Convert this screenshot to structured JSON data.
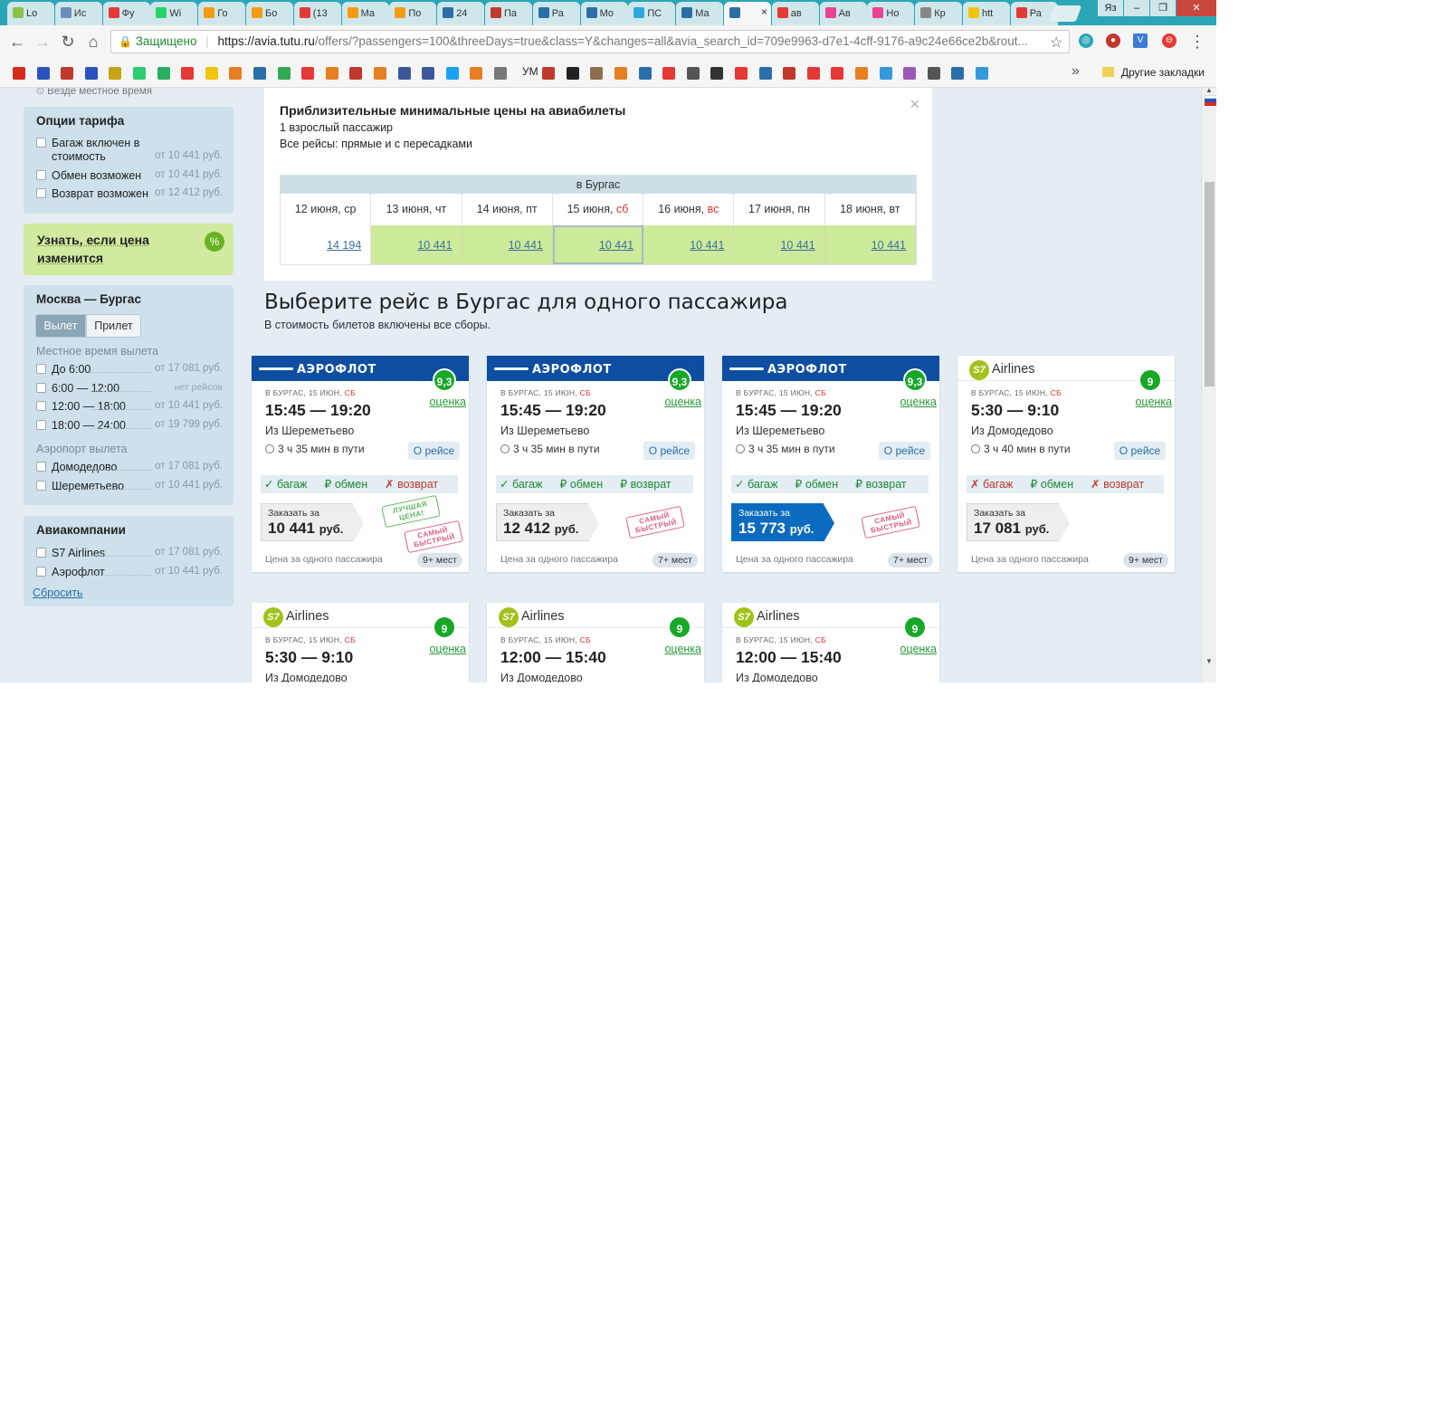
{
  "browser": {
    "tabs": [
      {
        "label": "Lo",
        "color": "#8bc34a"
      },
      {
        "label": "Ис",
        "color": "#6c8ebf"
      },
      {
        "label": "Фу",
        "color": "#e53935"
      },
      {
        "label": "Wi",
        "color": "#25d366"
      },
      {
        "label": "Го",
        "color": "#f39c12"
      },
      {
        "label": "Бо",
        "color": "#f39c12"
      },
      {
        "label": "(13",
        "color": "#e53935"
      },
      {
        "label": "Ма",
        "color": "#f39c12"
      },
      {
        "label": "По",
        "color": "#f39c12"
      },
      {
        "label": "24",
        "color": "#2a6fa8"
      },
      {
        "label": "Па",
        "color": "#c0392b"
      },
      {
        "label": "Ра",
        "color": "#2a6fa8"
      },
      {
        "label": "Мо",
        "color": "#2a6fa8"
      },
      {
        "label": "ПС",
        "color": "#29a8e0"
      },
      {
        "label": "Ма",
        "color": "#2a6fa8"
      },
      {
        "label": "",
        "color": "#2a6fa8"
      },
      {
        "label": "ав",
        "color": "#e53935"
      },
      {
        "label": "Ав",
        "color": "#e84393"
      },
      {
        "label": "Но",
        "color": "#e84393"
      },
      {
        "label": "Кр",
        "color": "#888"
      },
      {
        "label": "htt",
        "color": "#f1c40f"
      },
      {
        "label": "Ра",
        "color": "#e53935"
      }
    ],
    "active_tab_index": 15,
    "tab_close": "×",
    "omnibox": {
      "secure_label": "Защищено",
      "url_host": "https://avia.tutu.ru",
      "url_path": "/offers/?passengers=100&threeDays=true&class=Y&changes=all&avia_search_id=709e9963-d7e1-4cff-9176-a9c24e66ce2b&rout..."
    },
    "bookmarks_other": "Другие закладки",
    "bookmark_more": "»",
    "bookmark_um": "УМ"
  },
  "sidebar": {
    "tz_note": "Везде местное время",
    "tariff": {
      "title": "Опции тарифа",
      "options": [
        {
          "label": "Багаж включен в стоимость",
          "price": "от 10 441 руб."
        },
        {
          "label": "Обмен возможен",
          "price": "от 10 441 руб."
        },
        {
          "label": "Возврат возможен",
          "price": "от 12 412 руб."
        }
      ]
    },
    "notify": {
      "label": "Узнать, если цена изменится",
      "badge": "%"
    },
    "route": {
      "title": "Москва — Бургас",
      "toggle_dep": "Вылет",
      "toggle_arr": "Прилет",
      "time_head": "Местное время вылета",
      "times": [
        {
          "label": "До 6:00",
          "price": "от 17 081 руб."
        },
        {
          "label": "6:00 — 12:00",
          "price": "нет рейсов"
        },
        {
          "label": "12:00 — 18:00",
          "price": "от 10 441 руб."
        },
        {
          "label": "18:00 — 24:00",
          "price": "от 19 799 руб."
        }
      ],
      "airport_head": "Аэропорт вылета",
      "airports": [
        {
          "label": "Домодедово",
          "price": "от 17 081 руб."
        },
        {
          "label": "Шереметьево",
          "price": "от 10 441 руб."
        }
      ]
    },
    "airlines": {
      "title": "Авиакомпании",
      "items": [
        {
          "label": "S7 Airlines",
          "price": "от 17 081 руб."
        },
        {
          "label": "Аэрофлот",
          "price": "от 10 441 руб."
        }
      ],
      "reset": "Сбросить"
    }
  },
  "calendar": {
    "title": "Приблизительные минимальные цены на авиабилеты",
    "sub1": "1 взрослый пассажир",
    "sub2": "Все рейсы: прямые и с пересадками",
    "close": "×",
    "destination": "в Бургас",
    "days": [
      {
        "date": "12 июня,",
        "wd": "ср",
        "weekend": false,
        "price": "14 194",
        "cheap": false
      },
      {
        "date": "13 июня,",
        "wd": "чт",
        "weekend": false,
        "price": "10 441",
        "cheap": true
      },
      {
        "date": "14 июня,",
        "wd": "пт",
        "weekend": false,
        "price": "10 441",
        "cheap": true
      },
      {
        "date": "15 июня,",
        "wd": "сб",
        "weekend": true,
        "price": "10 441",
        "cheap": true,
        "selected": true
      },
      {
        "date": "16 июня,",
        "wd": "вс",
        "weekend": true,
        "price": "10 441",
        "cheap": true
      },
      {
        "date": "17 июня,",
        "wd": "пн",
        "weekend": false,
        "price": "10 441",
        "cheap": true
      },
      {
        "date": "18 июня,",
        "wd": "вт",
        "weekend": false,
        "price": "10 441",
        "cheap": true
      }
    ]
  },
  "results": {
    "title": "Выберите рейс в Бургас для одного пассажира",
    "subtitle": "В стоимость билетов включены все сборы.",
    "rating_label": "оценка",
    "about_label": "О рейсе",
    "book_label": "Заказать за",
    "currency": "руб.",
    "per_pax": "Цена за одного пассажира",
    "opt_baggage": "багаж",
    "opt_exchange": "обмен",
    "opt_refund": "возврат",
    "airline_logo_aero": "АЭРОФЛОТ",
    "airline_logo_s7_badge": "S7",
    "airline_logo_s7_text": "Airlines",
    "dir_prefix": "В БУРГАС, 15 ИЮН,",
    "dir_day": "СБ",
    "stamp_best": "ЛУЧШАЯ ЦЕНА!",
    "stamp_fast": "САМЫЙ БЫСТРЫЙ",
    "cards": [
      {
        "airline": "aero",
        "rating": "9,3",
        "time": "15:45 — 19:20",
        "from": "Из Шереметьево",
        "duration": "3 ч 35 мин в пути",
        "baggage": true,
        "exchange": "rub",
        "refund": false,
        "price": "10 441",
        "seats": "9+ мест",
        "stamps": [
          "best",
          "fast"
        ],
        "highlight": false
      },
      {
        "airline": "aero",
        "rating": "9,3",
        "time": "15:45 — 19:20",
        "from": "Из Шереметьево",
        "duration": "3 ч 35 мин в пути",
        "baggage": true,
        "exchange": "rub",
        "refund": "rub",
        "price": "12 412",
        "seats": "7+ мест",
        "stamps": [
          "fast"
        ],
        "highlight": false
      },
      {
        "airline": "aero",
        "rating": "9,3",
        "time": "15:45 — 19:20",
        "from": "Из Шереметьево",
        "duration": "3 ч 35 мин в пути",
        "baggage": true,
        "exchange": "rub",
        "refund": "rub",
        "price": "15 773",
        "seats": "7+ мест",
        "stamps": [
          "fast"
        ],
        "highlight": true
      },
      {
        "airline": "s7",
        "rating": "9",
        "time": "5:30 — 9:10",
        "from": "Из Домодедово",
        "duration": "3 ч 40 мин в пути",
        "baggage": false,
        "exchange": "rub",
        "refund": false,
        "price": "17 081",
        "seats": "9+ мест",
        "stamps": [],
        "highlight": false
      },
      {
        "airline": "s7",
        "rating": "9",
        "time": "5:30 — 9:10",
        "from": "Из Домодедово"
      },
      {
        "airline": "s7",
        "rating": "9",
        "time": "12:00 — 15:40",
        "from": "Из Домодедово"
      },
      {
        "airline": "s7",
        "rating": "9",
        "time": "12:00 — 15:40",
        "from": "Из Домодедово"
      }
    ]
  }
}
